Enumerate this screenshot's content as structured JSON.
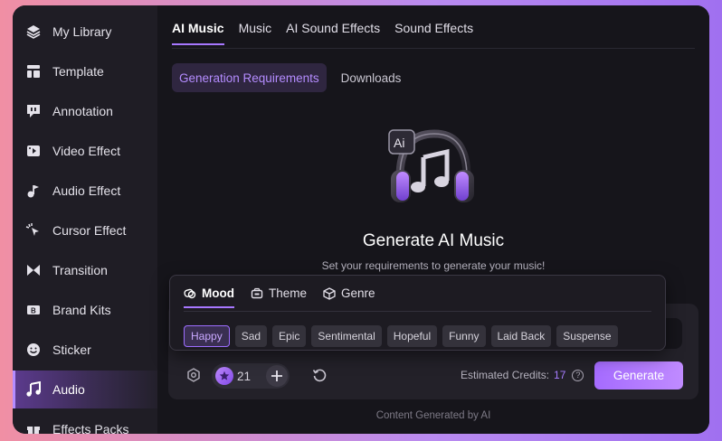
{
  "sidebar": {
    "items": [
      {
        "label": "My Library",
        "icon": "layers-icon"
      },
      {
        "label": "Template",
        "icon": "template-icon"
      },
      {
        "label": "Annotation",
        "icon": "annotation-icon"
      },
      {
        "label": "Video Effect",
        "icon": "video-effect-icon"
      },
      {
        "label": "Audio Effect",
        "icon": "audio-effect-icon"
      },
      {
        "label": "Cursor Effect",
        "icon": "cursor-icon"
      },
      {
        "label": "Transition",
        "icon": "transition-icon"
      },
      {
        "label": "Brand Kits",
        "icon": "brand-kit-icon"
      },
      {
        "label": "Sticker",
        "icon": "sticker-icon"
      },
      {
        "label": "Audio",
        "icon": "music-note-icon",
        "active": true
      },
      {
        "label": "Effects Packs",
        "icon": "gift-icon"
      }
    ]
  },
  "tabs": [
    "AI Music",
    "Music",
    "AI Sound Effects",
    "Sound Effects"
  ],
  "subtabs": [
    "Generation Requirements",
    "Downloads"
  ],
  "hero": {
    "title": "Generate AI Music",
    "subtitle": "Set your requirements to generate your music!",
    "badge": "Ai"
  },
  "popup": {
    "tabs": [
      "Mood",
      "Theme",
      "Genre"
    ],
    "chips": [
      "Happy",
      "Sad",
      "Epic",
      "Sentimental",
      "Hopeful",
      "Funny",
      "Laid Back",
      "Suspense"
    ]
  },
  "toolbar": {
    "credit_count": "21",
    "estimated_label": "Estimated Credits:",
    "estimated_value": "17",
    "help": "?",
    "generate_label": "Generate"
  },
  "footer": "Content Generated by AI",
  "colors": {
    "accent": "#a777ff",
    "active_chip_text": "#c9a8ff",
    "background": "#16151b"
  }
}
